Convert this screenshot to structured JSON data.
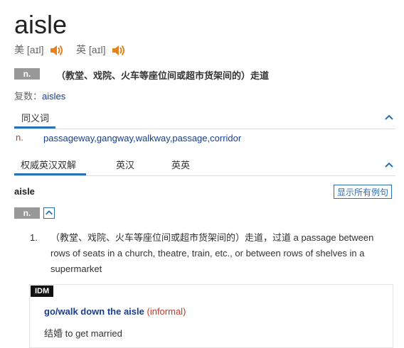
{
  "headword": "aisle",
  "pronunciations": [
    {
      "region": "美",
      "ipa": "[aɪl]"
    },
    {
      "region": "英",
      "ipa": "[aɪl]"
    }
  ],
  "basic": {
    "pos": "n.",
    "definition": "（教堂、戏院、火车等座位间或超市货架间的）走道",
    "plural_label": "复数：",
    "plural_value": "aisles"
  },
  "synonyms": {
    "title": "同义词",
    "pos": "n.",
    "list": "passageway,gangway,walkway,passage,corridor"
  },
  "tabs": [
    "权威英汉双解",
    "英汉",
    "英英"
  ],
  "entry": {
    "word": "aisle",
    "show_all_label": "显示所有例句",
    "pos": "n.",
    "sense_number": "1.",
    "sense_text": "（教堂、戏院、火车等座位间或超市货架间的）走道，过道 a passage between rows of seats in a church, theatre, train, etc., or between rows of shelves in a supermarket",
    "idm": {
      "tag": "IDM",
      "phrase": "go/walk down the aisle",
      "register": "(informal)",
      "gloss": "结婚 to get married"
    }
  },
  "colors": {
    "accent": "#2b6fb7",
    "speaker": "#e8821e",
    "pos_badge": "#999999"
  }
}
